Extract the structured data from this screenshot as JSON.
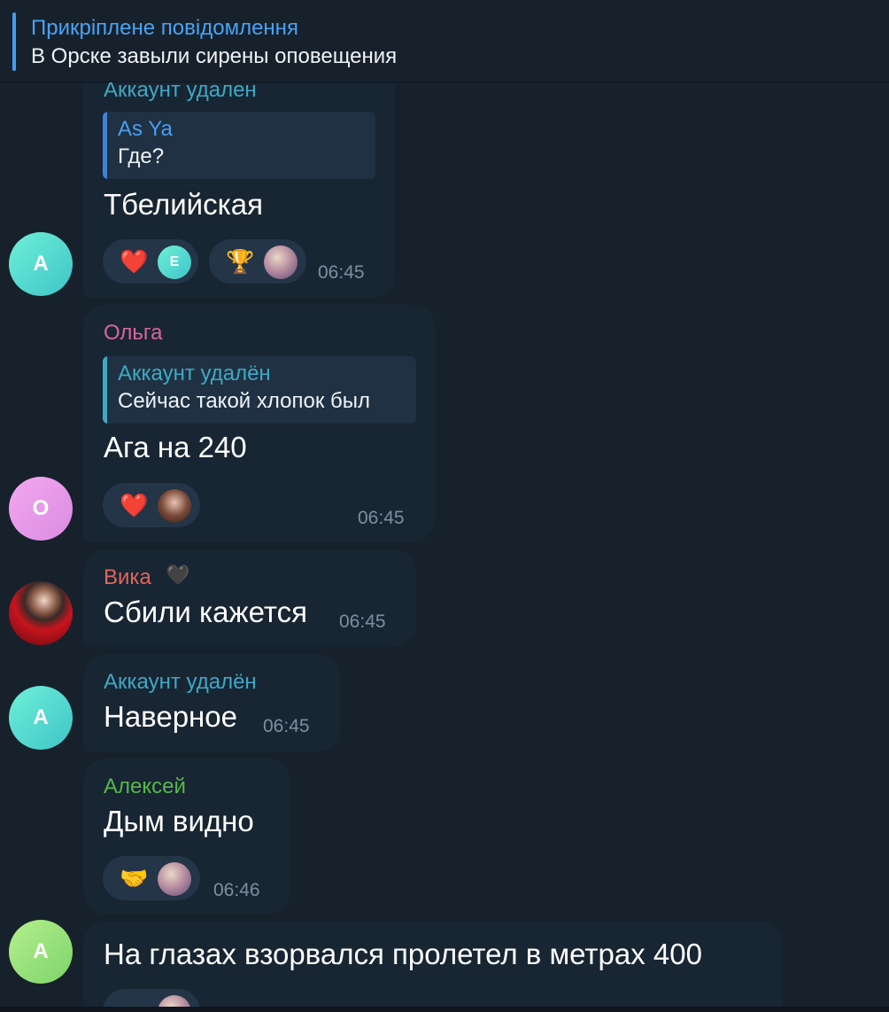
{
  "pinned": {
    "title": "Прикріплене повідомлення",
    "text": "В Орске завыли сирены оповещения"
  },
  "messages": [
    {
      "sender": "Аккаунт удален",
      "reply_name": "As Ya",
      "reply_text": "Где?",
      "text": "Тбелийская",
      "time": "06:45",
      "avatar_letter": "А",
      "reactions": [
        {
          "emoji": "❤️",
          "avatar_letter": "E"
        },
        {
          "emoji": "🏆"
        }
      ]
    },
    {
      "sender": "Ольга",
      "reply_name": "Аккаунт удалён",
      "reply_text": "Сейчас такой хлопок был",
      "text": "Ага на 240",
      "time": "06:45",
      "avatar_letter": "О",
      "reactions": [
        {
          "emoji": "❤️"
        }
      ]
    },
    {
      "sender": "Вика",
      "sender_badge": "🖤",
      "text": "Сбили кажется",
      "time": "06:45"
    },
    {
      "sender": "Аккаунт удалён",
      "text": "Наверное",
      "time": "06:45",
      "avatar_letter": "А"
    },
    {
      "sender": "Алексей",
      "text": "Дым видно",
      "time": "06:46",
      "reactions": [
        {
          "emoji": "🤝"
        }
      ]
    },
    {
      "text": "На глазах взорвался пролетел в метрах 400",
      "avatar_letter": "А"
    }
  ],
  "colors": {
    "background": "#17212b",
    "bubble": "#182533",
    "accent": "#49a3f5",
    "sender_deleted": "#3fa9c4",
    "sender_olga": "#d9669a",
    "sender_vika": "#e0665c",
    "sender_aleksey": "#56b84a"
  }
}
